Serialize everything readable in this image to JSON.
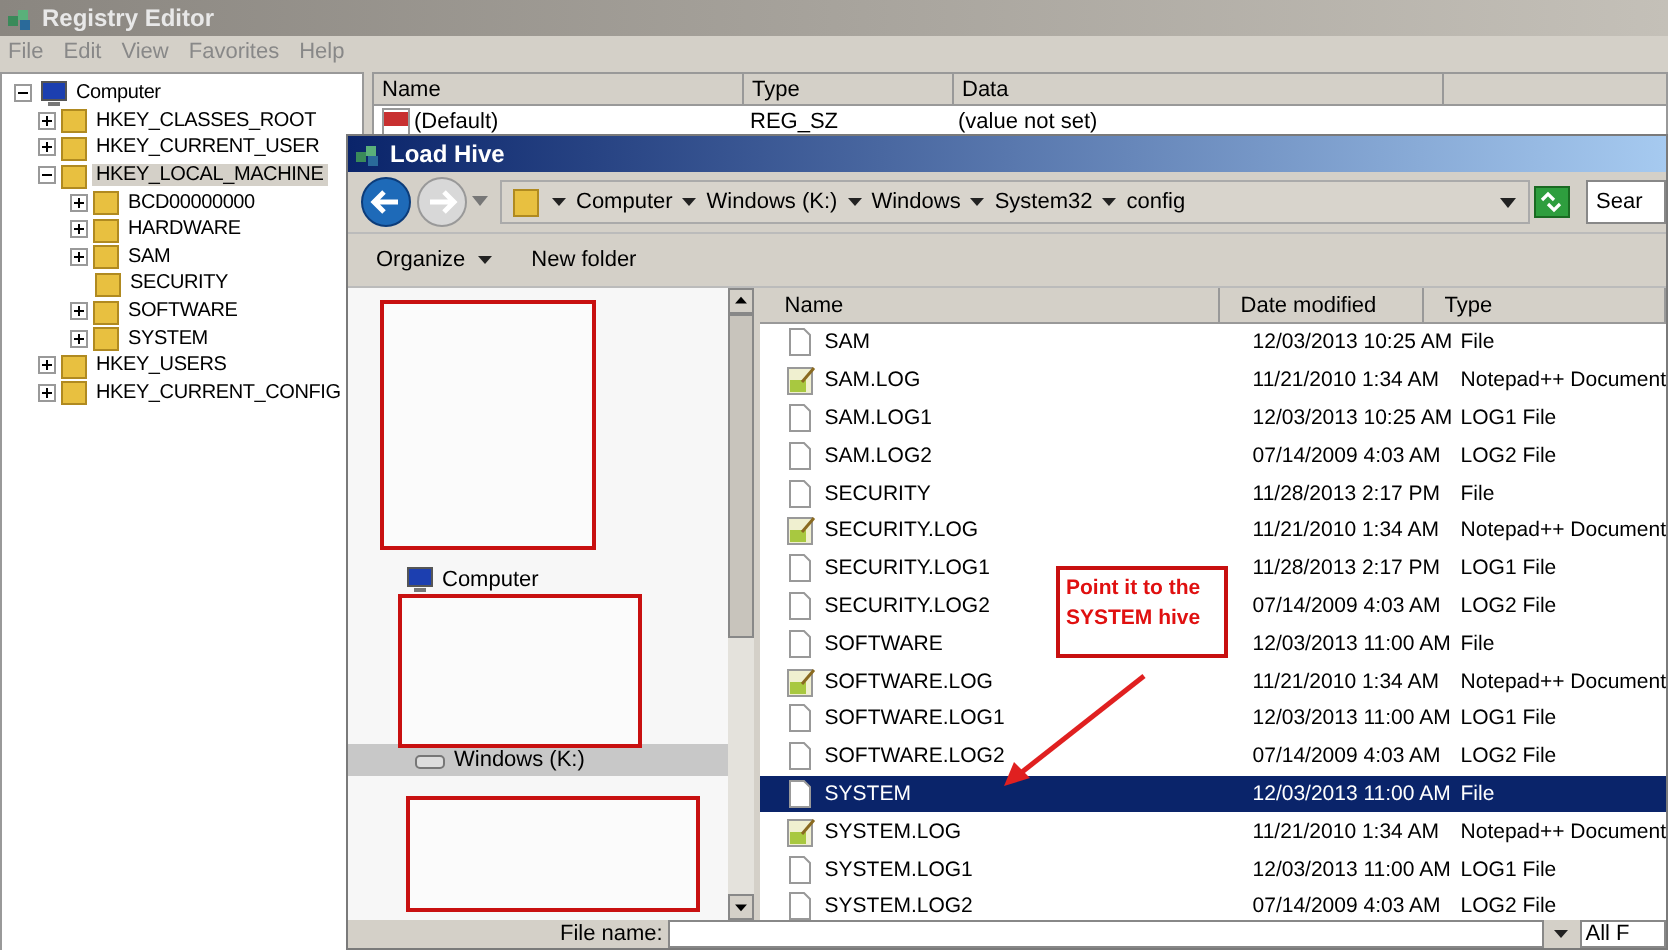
{
  "window": {
    "title": "Registry Editor"
  },
  "menu": [
    "File",
    "Edit",
    "View",
    "Favorites",
    "Help"
  ],
  "tree": {
    "label": "Computer",
    "expanded": true,
    "selected": false,
    "children": [
      {
        "label": "HKEY_CLASSES_ROOT",
        "expanded": false,
        "selected": false
      },
      {
        "label": "HKEY_CURRENT_USER",
        "expanded": false,
        "selected": false
      },
      {
        "label": "HKEY_LOCAL_MACHINE",
        "expanded": true,
        "selected": true,
        "children": [
          {
            "label": "BCD00000000",
            "selected": false,
            "has_children": true
          },
          {
            "label": "HARDWARE",
            "selected": false,
            "has_children": true
          },
          {
            "label": "SAM",
            "selected": false,
            "has_children": true
          },
          {
            "label": "SECURITY",
            "selected": false,
            "has_children": false
          },
          {
            "label": "SOFTWARE",
            "selected": false,
            "has_children": true
          },
          {
            "label": "SYSTEM",
            "selected": false,
            "has_children": true
          }
        ]
      },
      {
        "label": "HKEY_USERS",
        "expanded": false,
        "selected": false
      },
      {
        "label": "HKEY_CURRENT_CONFIG",
        "expanded": false,
        "selected": false
      }
    ]
  },
  "values": {
    "columns": [
      "Name",
      "Type",
      "Data"
    ],
    "rows": [
      {
        "name": "(Default)",
        "type": "REG_SZ",
        "data": "(value not set)"
      }
    ]
  },
  "dialog": {
    "title": "Load Hive",
    "breadcrumb": [
      "Computer",
      "Windows (K:)",
      "Windows",
      "System32",
      "config"
    ],
    "search": {
      "placeholder": "Sear"
    },
    "toolbar": [
      "Organize",
      "New folder"
    ],
    "nav_items": [
      {
        "label": "Computer",
        "kind": "computer",
        "selected": false
      },
      {
        "label": "Windows (K:)",
        "kind": "drive",
        "selected": true
      }
    ],
    "columns": [
      "Name",
      "Date modified",
      "Type"
    ],
    "files": [
      {
        "name": "SAM",
        "date": "12/03/2013 10:25 AM",
        "type": "File",
        "kind": "file",
        "selected": false
      },
      {
        "name": "SAM.LOG",
        "date": "11/21/2010 1:34 AM",
        "type": "Notepad++ Document",
        "kind": "notepad",
        "selected": false
      },
      {
        "name": "SAM.LOG1",
        "date": "12/03/2013 10:25 AM",
        "type": "LOG1 File",
        "kind": "file",
        "selected": false
      },
      {
        "name": "SAM.LOG2",
        "date": "07/14/2009 4:03 AM",
        "type": "LOG2 File",
        "kind": "file",
        "selected": false
      },
      {
        "name": "SECURITY",
        "date": "11/28/2013 2:17 PM",
        "type": "File",
        "kind": "file",
        "selected": false
      },
      {
        "name": "SECURITY.LOG",
        "date": "11/21/2010 1:34 AM",
        "type": "Notepad++ Document",
        "kind": "notepad",
        "selected": false
      },
      {
        "name": "SECURITY.LOG1",
        "date": "11/28/2013 2:17 PM",
        "type": "LOG1 File",
        "kind": "file",
        "selected": false
      },
      {
        "name": "SECURITY.LOG2",
        "date": "07/14/2009 4:03 AM",
        "type": "LOG2 File",
        "kind": "file",
        "selected": false
      },
      {
        "name": "SOFTWARE",
        "date": "12/03/2013 11:00 AM",
        "type": "File",
        "kind": "file",
        "selected": false
      },
      {
        "name": "SOFTWARE.LOG",
        "date": "11/21/2010 1:34 AM",
        "type": "Notepad++ Document",
        "kind": "notepad",
        "selected": false
      },
      {
        "name": "SOFTWARE.LOG1",
        "date": "12/03/2013 11:00 AM",
        "type": "LOG1 File",
        "kind": "file",
        "selected": false
      },
      {
        "name": "SOFTWARE.LOG2",
        "date": "07/14/2009 4:03 AM",
        "type": "LOG2 File",
        "kind": "file",
        "selected": false
      },
      {
        "name": "SYSTEM",
        "date": "12/03/2013 11:00 AM",
        "type": "File",
        "kind": "file",
        "selected": true
      },
      {
        "name": "SYSTEM.LOG",
        "date": "11/21/2010 1:34 AM",
        "type": "Notepad++ Document",
        "kind": "notepad",
        "selected": false
      },
      {
        "name": "SYSTEM.LOG1",
        "date": "12/03/2013 11:00 AM",
        "type": "LOG1 File",
        "kind": "file",
        "selected": false
      },
      {
        "name": "SYSTEM.LOG2",
        "date": "07/14/2009 4:03 AM",
        "type": "LOG2 File",
        "kind": "file",
        "selected": false
      }
    ],
    "file_name_label": "File name:",
    "file_type": "All F"
  },
  "annotation": "Point it to the SYSTEM hive"
}
